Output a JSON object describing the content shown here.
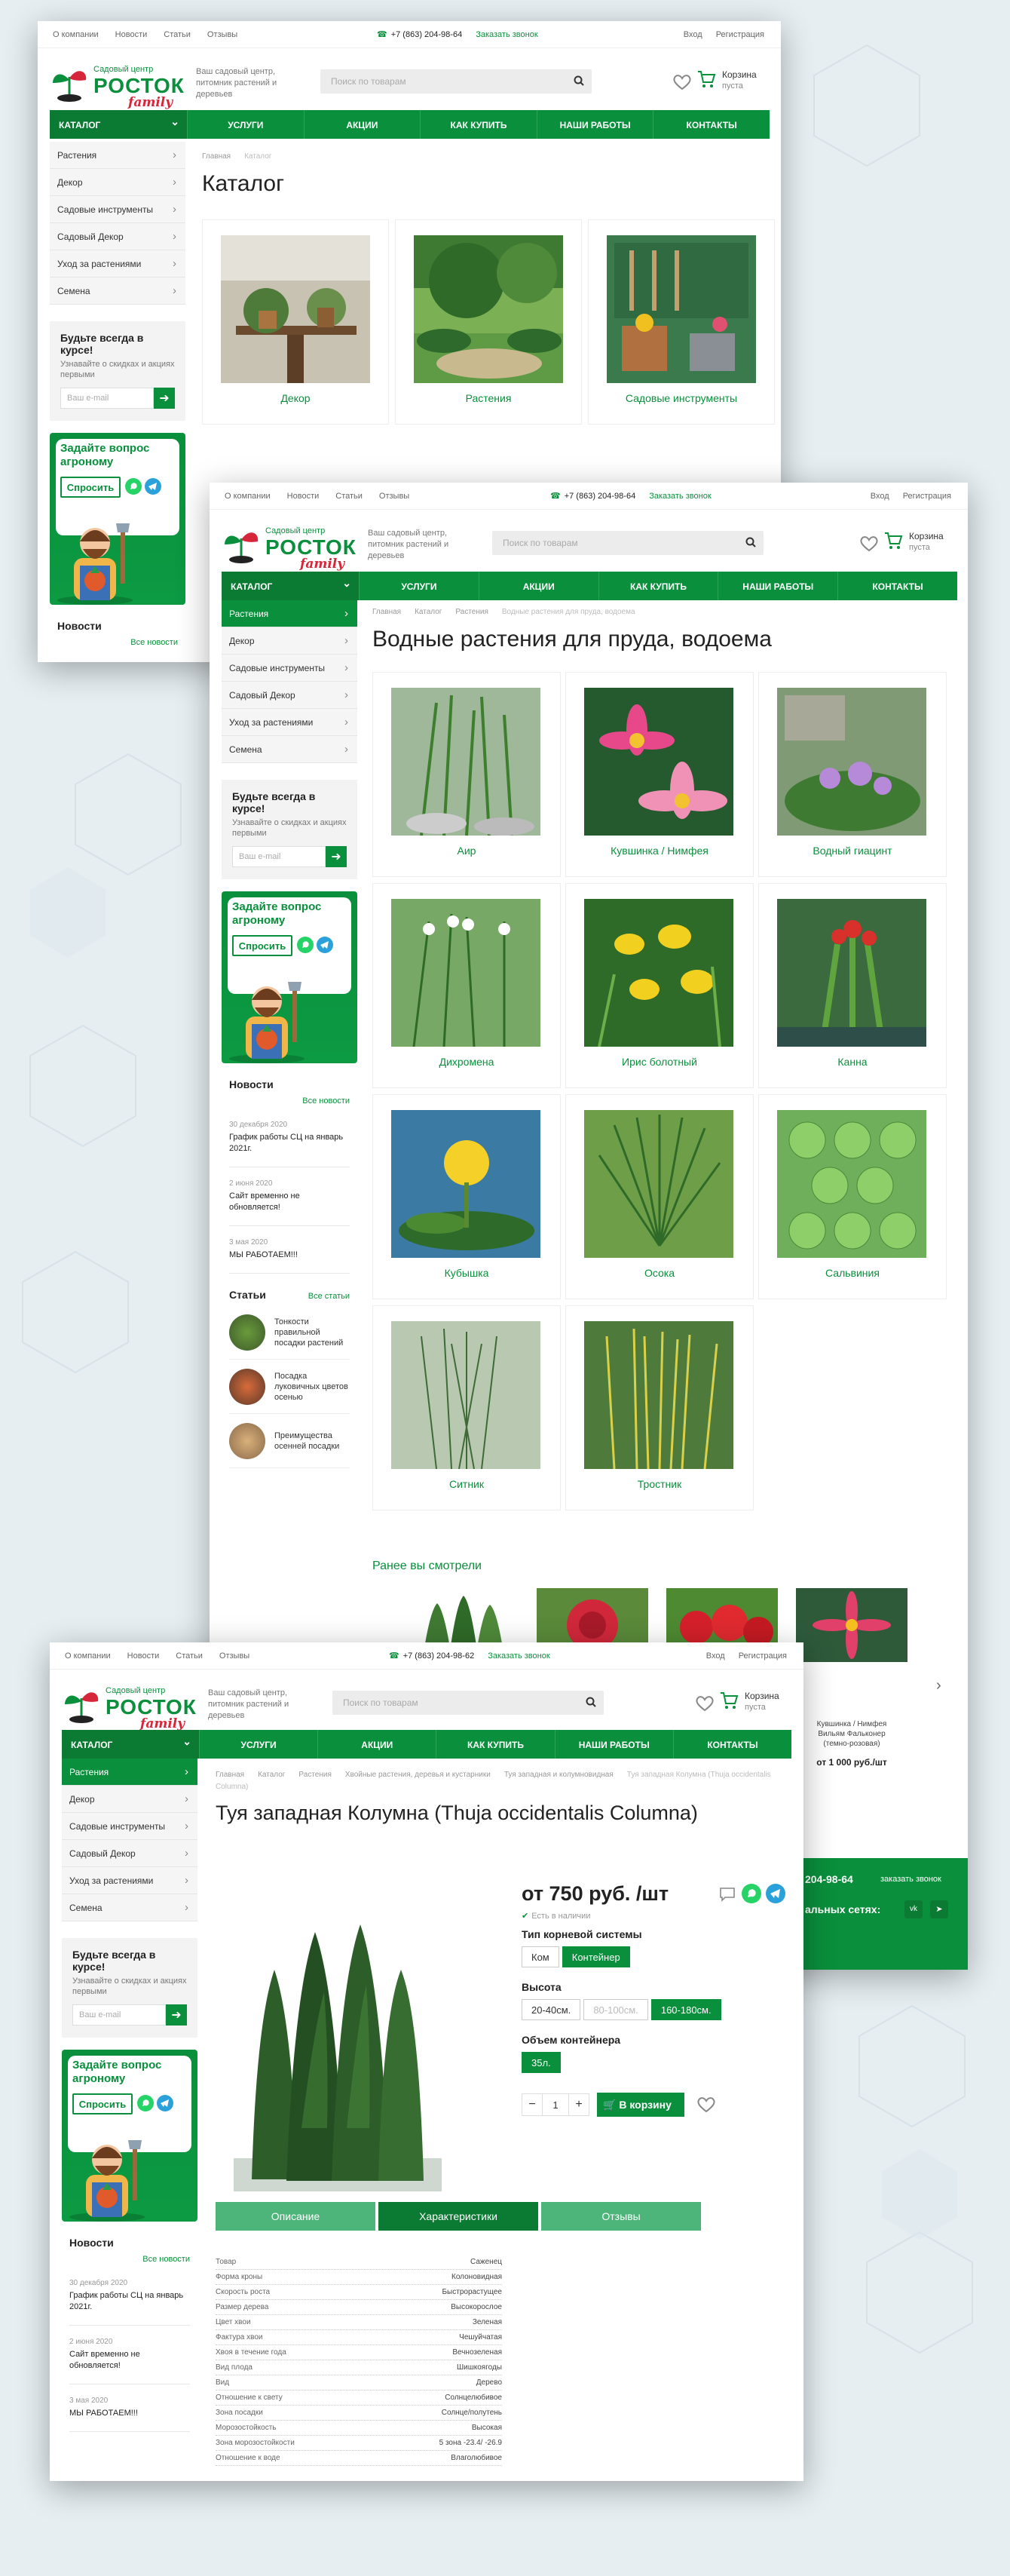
{
  "topbar": {
    "links": [
      "О компании",
      "Новости",
      "Статьи",
      "Отзывы"
    ],
    "phone": "+7 (863) 204-98-64",
    "phone_alt": "+7 (863) 204-98-62",
    "call": "Заказать звонок",
    "login": "Вход",
    "register": "Регистрация"
  },
  "header": {
    "logo_sub": "Садовый центр",
    "logo_name": "РОСТОК",
    "logo_family": "family",
    "slogan": "Ваш садовый центр, питомник растений и деревьев",
    "search_placeholder": "Поиск по товарам",
    "cart_title": "Корзина",
    "cart_state": "пуста"
  },
  "nav": {
    "catalog": "КАТАЛОГ",
    "items": [
      "УСЛУГИ",
      "АКЦИИ",
      "КАК КУПИТЬ",
      "НАШИ РАБОТЫ",
      "КОНТАКТЫ"
    ]
  },
  "sidebar": {
    "menu": [
      "Растения",
      "Декор",
      "Садовые инструменты",
      "Садовый Декор",
      "Уход за растениями",
      "Семена"
    ]
  },
  "subscribe": {
    "title": "Будьте всегда в курсе!",
    "desc": "Узнавайте о скидках и акциях первыми",
    "placeholder": "Ваш e-mail"
  },
  "ask": {
    "title": "Задайте вопрос агроному",
    "button": "Спросить"
  },
  "news": {
    "title": "Новости",
    "all": "Все новости",
    "items": [
      {
        "date": "30 декабря 2020",
        "text": "График работы СЦ на январь 2021г."
      },
      {
        "date": "2 июня 2020",
        "text": "Сайт временно не обновляется!"
      },
      {
        "date": "3 мая 2020",
        "text": "МЫ РАБОТАЕМ!!!"
      }
    ]
  },
  "articles": {
    "title": "Статьи",
    "all": "Все статьи",
    "items": [
      "Тонкости правильной посадки растений",
      "Посадка луковичных цветов осенью",
      "Преимущества осенней посадки"
    ]
  },
  "page1": {
    "crumbs": [
      "Главная",
      "Каталог"
    ],
    "title": "Каталог",
    "cards": [
      "Декор",
      "Растения",
      "Садовые инструменты"
    ]
  },
  "page2": {
    "crumbs": [
      "Главная",
      "Каталог",
      "Растения",
      "Водные растения для пруда, водоема"
    ],
    "title": "Водные растения для пруда, водоема",
    "cards": [
      "Аир",
      "Кувшинка / Нимфея",
      "Водный гиацинт",
      "Дихромена",
      "Ирис болотный",
      "Канна",
      "Кубышка",
      "Осока",
      "Сальвиния",
      "Ситник",
      "Тростник"
    ],
    "recently": "Ранее вы смотрели",
    "recent_item": "Кувшинка / Нимфея Вильям Фальконер (темно-розовая)",
    "recent_price": "от 1 000 руб./шт",
    "footer_phone": "204-98-64",
    "footer_call": "заказать звонок",
    "footer_social": "альных сетях:"
  },
  "page3": {
    "crumbs": [
      "Главная",
      "Каталог",
      "Растения",
      "Хвойные растения, деревья и кустарники",
      "Туя западная и колумновидная",
      "Туя западная Колумна (Thuja occidentalis Columna)"
    ],
    "title": "Туя западная Колумна (Thuja occidentalis Columna)",
    "price": "от 750 руб. /шт",
    "availability": "Есть в наличии",
    "root_label": "Тип корневой системы",
    "root_options": [
      "Ком",
      "Контейнер"
    ],
    "height_label": "Высота",
    "height_options": [
      "20-40см.",
      "80-100см.",
      "160-180см."
    ],
    "volume_label": "Объем контейнера",
    "volume_options": [
      "35л."
    ],
    "qty": "1",
    "to_cart": "В корзину",
    "tabs": [
      "Описание",
      "Характеристики",
      "Отзывы"
    ],
    "chars": [
      [
        "Товар",
        "Саженец"
      ],
      [
        "Форма кроны",
        "Колоновидная"
      ],
      [
        "Скорость роста",
        "Быстрорастущее"
      ],
      [
        "Размер дерева",
        "Высокорослое"
      ],
      [
        "Цвет хвои",
        "Зеленая"
      ],
      [
        "Фактура хвои",
        "Чешуйчатая"
      ],
      [
        "Хвоя в течение года",
        "Вечнозеленая"
      ],
      [
        "Вид плода",
        "Шишкоягоды"
      ],
      [
        "Вид",
        "Дерево"
      ],
      [
        "Отношение к свету",
        "Солнцелюбивое"
      ],
      [
        "Зона посадки",
        "Солнце/полутень"
      ],
      [
        "Морозостойкость",
        "Высокая"
      ],
      [
        "Зона морозостойкости",
        "5 зона -23.4/ -26.9"
      ],
      [
        "Отношение к воде",
        "Влаголюбивое"
      ]
    ]
  },
  "colors": {
    "brand": "#0a8f3c",
    "brand_dark": "#0b7a33",
    "accent_red": "#d6273a"
  }
}
